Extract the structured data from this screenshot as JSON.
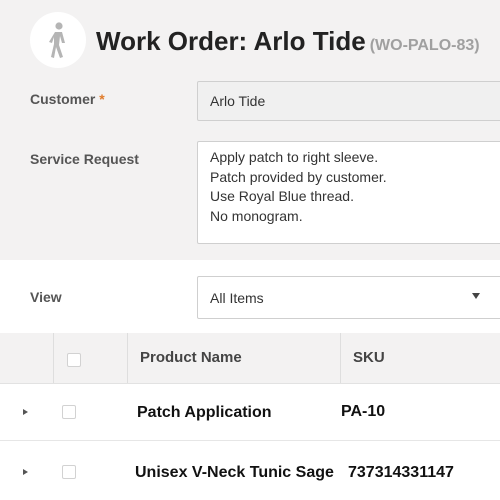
{
  "header": {
    "icon": "person-walking-icon",
    "title": "Work Order: Arlo Tide",
    "code": "(WO-PALO-83)"
  },
  "form": {
    "customer": {
      "label": "Customer",
      "required_mark": "*",
      "value": "Arlo Tide"
    },
    "service_request": {
      "label": "Service Request",
      "lines": [
        "Apply patch to right sleeve.",
        "Patch provided by customer.",
        "Use Royal Blue thread.",
        "No monogram."
      ]
    }
  },
  "view": {
    "label": "View",
    "selected": "All Items"
  },
  "table": {
    "columns": [
      "Product Name",
      "SKU"
    ],
    "rows": [
      {
        "product": "Patch Application",
        "sku": "PA-10"
      },
      {
        "product": "Unisex V-Neck Tunic Sage",
        "sku": "737314331147"
      }
    ]
  },
  "colors": {
    "required": "#e07b2a",
    "header_bg": "#f3f2f2"
  }
}
